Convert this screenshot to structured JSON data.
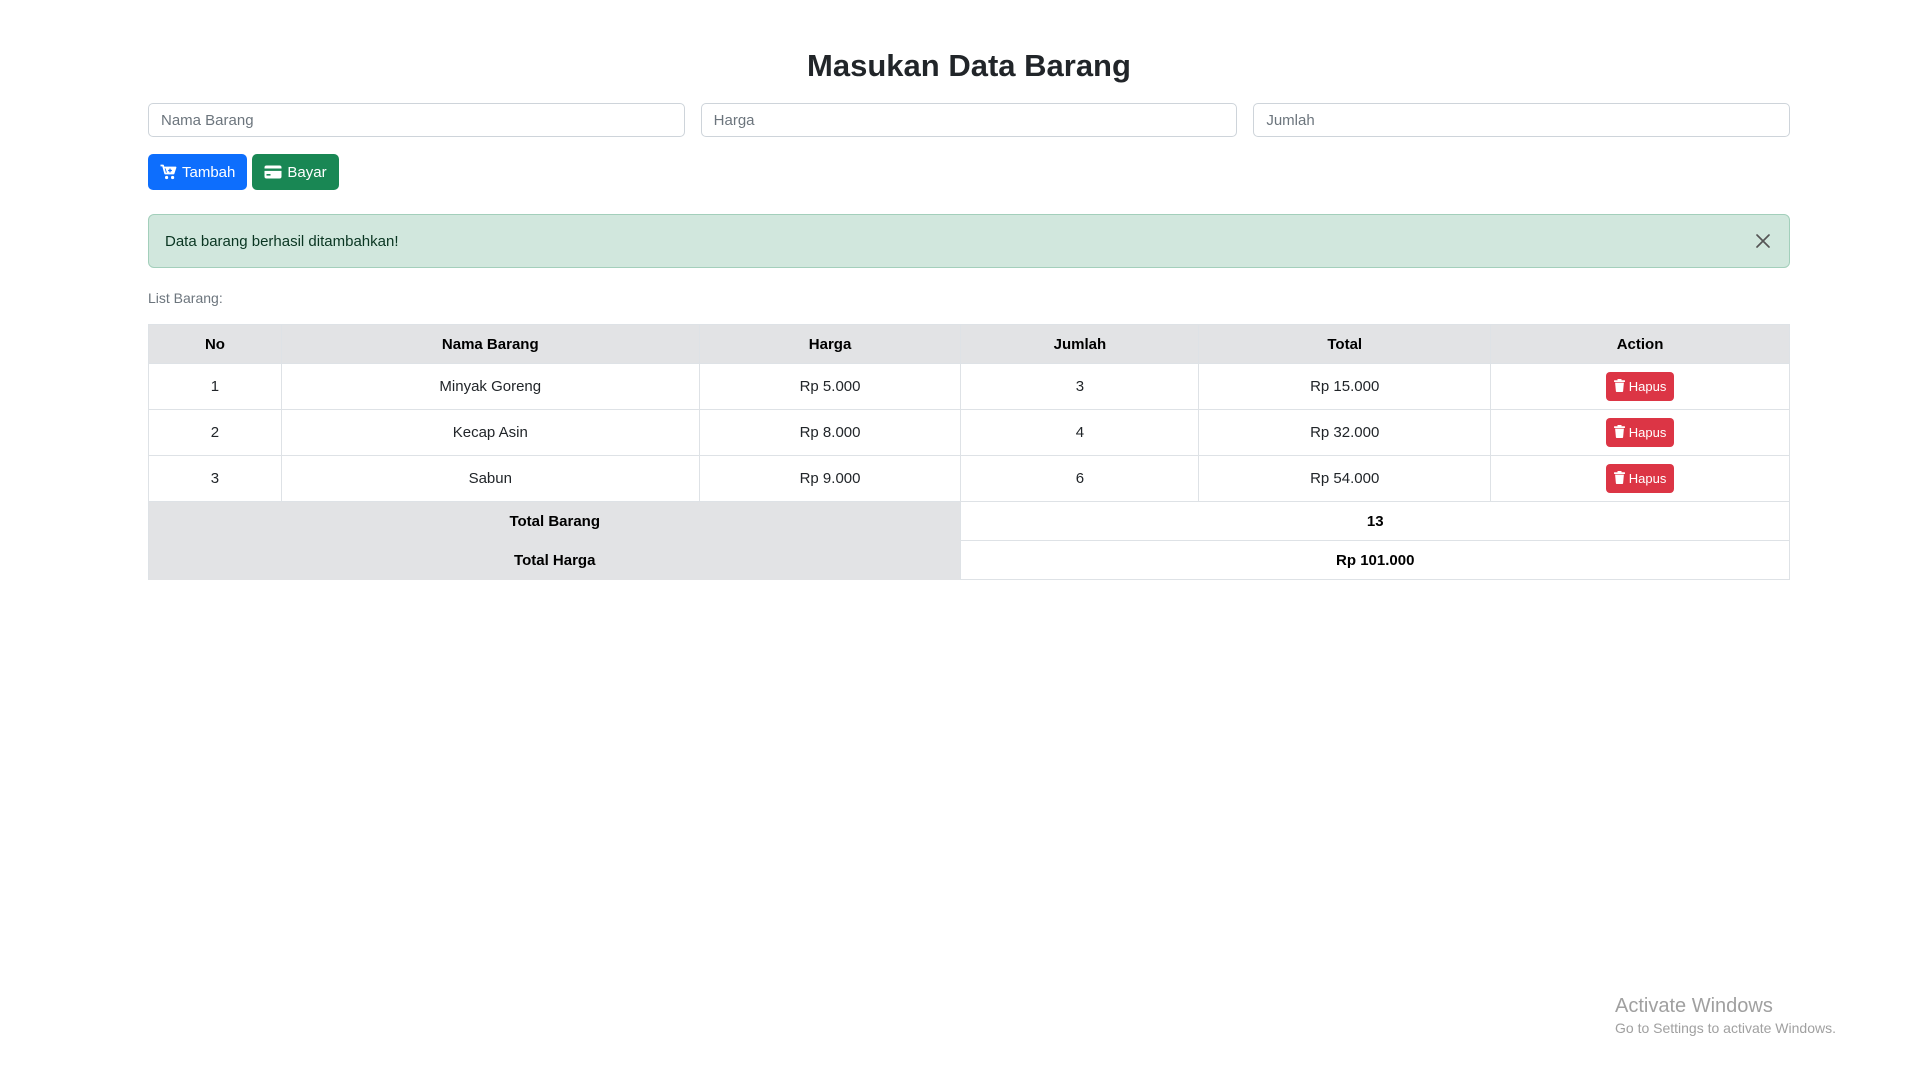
{
  "header": {
    "title": "Masukan Data Barang"
  },
  "form": {
    "nama_placeholder": "Nama Barang",
    "harga_placeholder": "Harga",
    "jumlah_placeholder": "Jumlah",
    "add_label": "Tambah",
    "pay_label": "Bayar"
  },
  "alert": {
    "message": "Data barang berhasil ditambahkan!"
  },
  "list": {
    "label": "List Barang:",
    "columns": [
      "No",
      "Nama Barang",
      "Harga",
      "Jumlah",
      "Total",
      "Action"
    ],
    "rows": [
      {
        "no": "1",
        "nama": "Minyak Goreng",
        "harga": "Rp 5.000",
        "jumlah": "3",
        "total": "Rp 15.000",
        "action": "Hapus"
      },
      {
        "no": "2",
        "nama": "Kecap Asin",
        "harga": "Rp 8.000",
        "jumlah": "4",
        "total": "Rp 32.000",
        "action": "Hapus"
      },
      {
        "no": "3",
        "nama": "Sabun",
        "harga": "Rp 9.000",
        "jumlah": "6",
        "total": "Rp 54.000",
        "action": "Hapus"
      }
    ],
    "summary": {
      "total_barang_label": "Total Barang",
      "total_barang_value": "13",
      "total_harga_label": "Total Harga",
      "total_harga_value": "Rp 101.000"
    }
  },
  "watermark": {
    "title": "Activate Windows",
    "subtitle": "Go to Settings to activate Windows."
  },
  "colors": {
    "primary": "#0d6efd",
    "success": "#198754",
    "danger": "#dc3545",
    "alert_bg": "#d1e7dd",
    "table_head": "#e2e3e5"
  },
  "icons": {
    "add_button": "cart-plus-icon",
    "pay_button": "credit-card-icon",
    "alert_close": "close-icon",
    "delete_button": "trash-icon"
  }
}
